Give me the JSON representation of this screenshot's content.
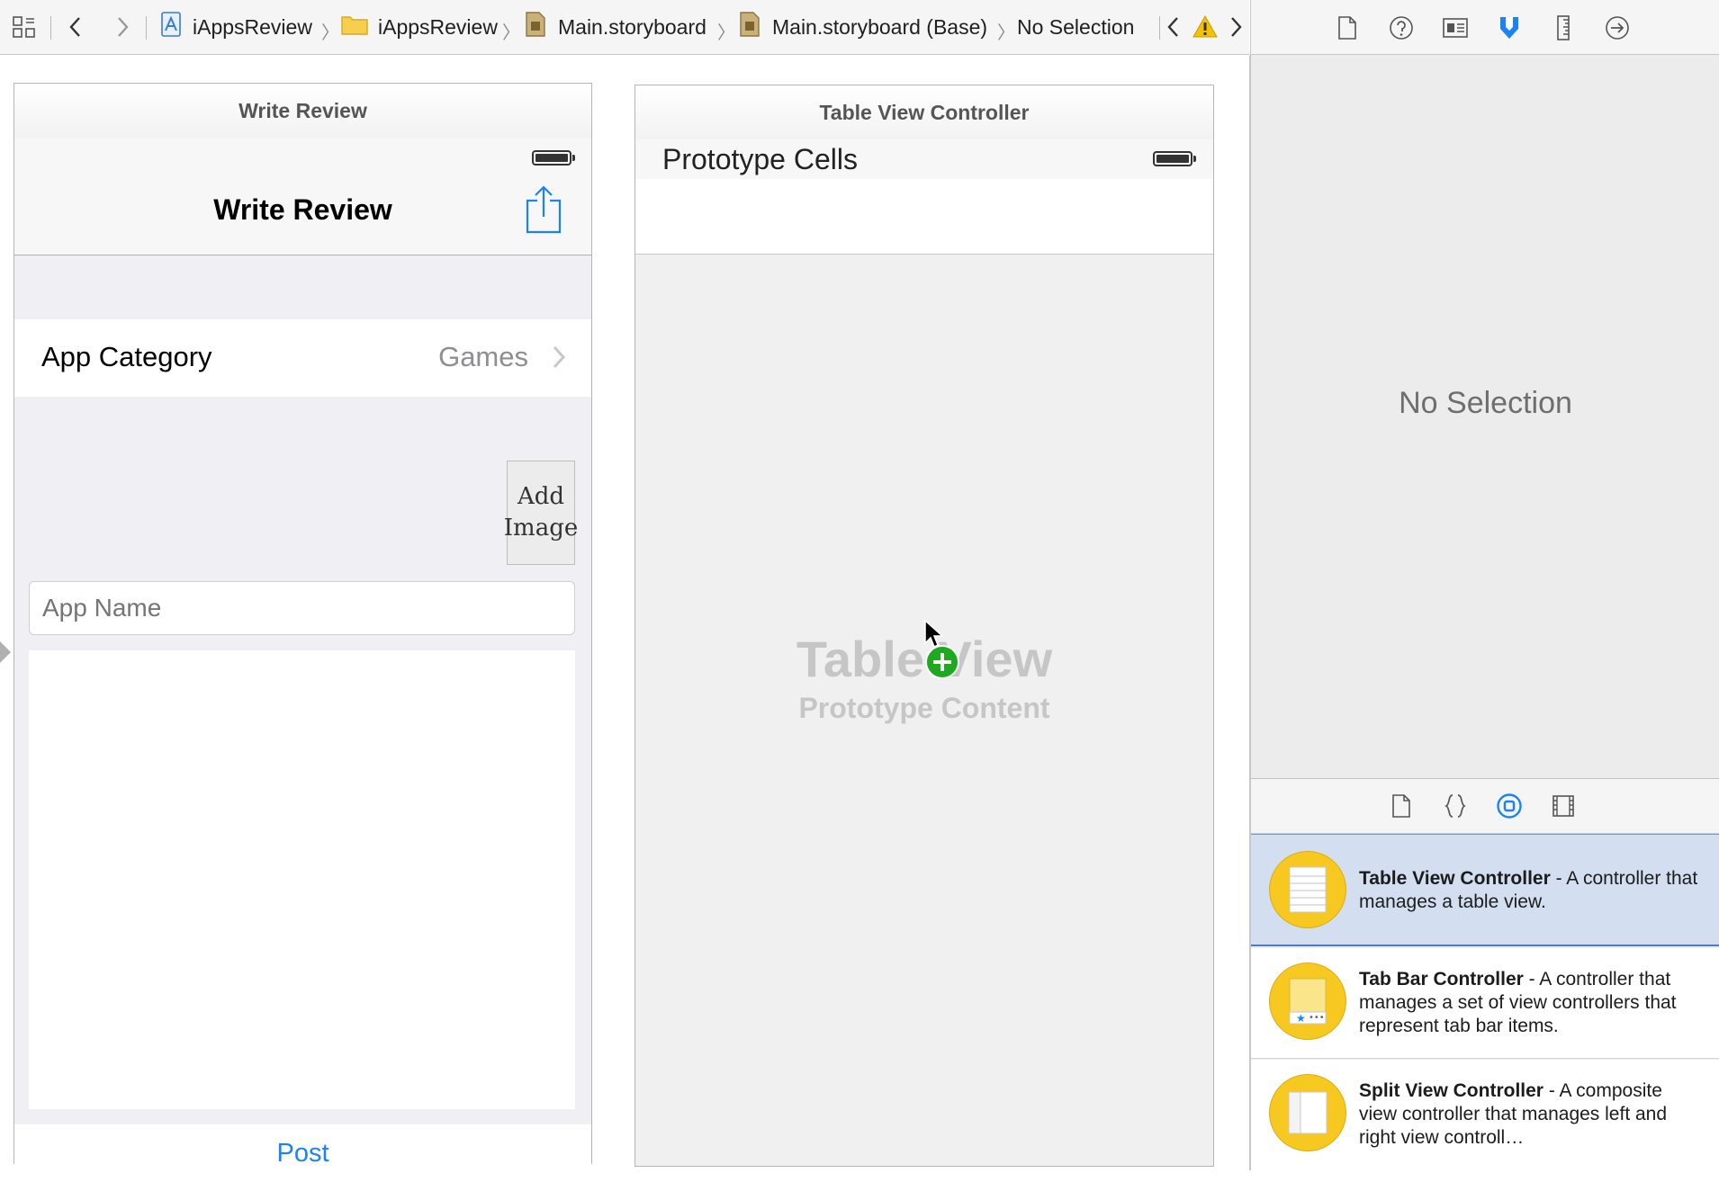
{
  "jumpbar": {
    "crumbs": [
      "iAppsReview",
      "iAppsReview",
      "Main.storyboard",
      "Main.storyboard (Base)",
      "No Selection"
    ]
  },
  "scenes": {
    "write_review": {
      "dock_title": "Write Review",
      "nav_title": "Write Review",
      "row_label": "App Category",
      "row_value": "Games",
      "add_image_line1": "Add",
      "add_image_line2": "Image",
      "app_name_placeholder": "App Name",
      "post_label": "Post"
    },
    "table_view": {
      "dock_title": "Table View Controller",
      "prototype_header": "Prototype Cells",
      "placeholder_title": "Table View",
      "placeholder_subtitle": "Prototype Content"
    }
  },
  "inspector": {
    "empty_message": "No Selection"
  },
  "library": {
    "items": [
      {
        "name": "Table View Controller",
        "desc": " - A controller that manages a table view."
      },
      {
        "name": "Tab Bar Controller",
        "desc": " - A controller that manages a set of view controllers that represent tab bar items."
      },
      {
        "name": "Split View Controller",
        "desc": " - A composite view controller that manages left and right view controll…"
      }
    ]
  },
  "colors": {
    "accent": "#1a82fb",
    "library_icon": "#f7c81f",
    "selection": "#d3dff0",
    "warning": "#f5c200",
    "add_badge": "#1fa91f"
  }
}
